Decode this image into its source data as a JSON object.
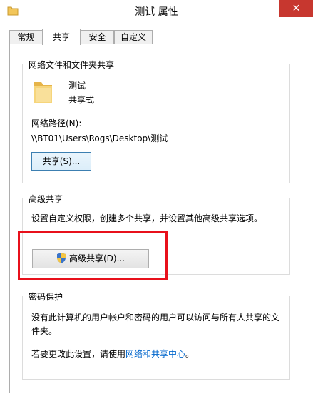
{
  "window": {
    "title": "测试 属性",
    "close_glyph": "✕"
  },
  "tabs": [
    {
      "label": "常规",
      "active": false
    },
    {
      "label": "共享",
      "active": true
    },
    {
      "label": "安全",
      "active": false
    },
    {
      "label": "自定义",
      "active": false
    }
  ],
  "network_sharing": {
    "group_title": "网络文件和文件夹共享",
    "folder_name": "测试",
    "share_status": "共享式",
    "path_label": "网络路径(N):",
    "path_value": "\\\\BT01\\Users\\Rogs\\Desktop\\测试",
    "share_button": "共享(S)..."
  },
  "advanced_sharing": {
    "group_title": "高级共享",
    "description": "设置自定义权限，创建多个共享，并设置其他高级共享选项。",
    "button": "高级共享(D)..."
  },
  "password_protection": {
    "group_title": "密码保护",
    "description_line1": "没有此计算机的用户帐户和密码的用户可以访问与所有人共享的文",
    "description_line2": "件夹。",
    "change_prefix": "若要更改此设置，请使用",
    "link_text": "网络和共享中心",
    "change_suffix": "。"
  },
  "colors": {
    "highlight": "#e8101b",
    "close_button": "#c7372f",
    "link": "#0066cc",
    "folder": "#f2c65a"
  }
}
